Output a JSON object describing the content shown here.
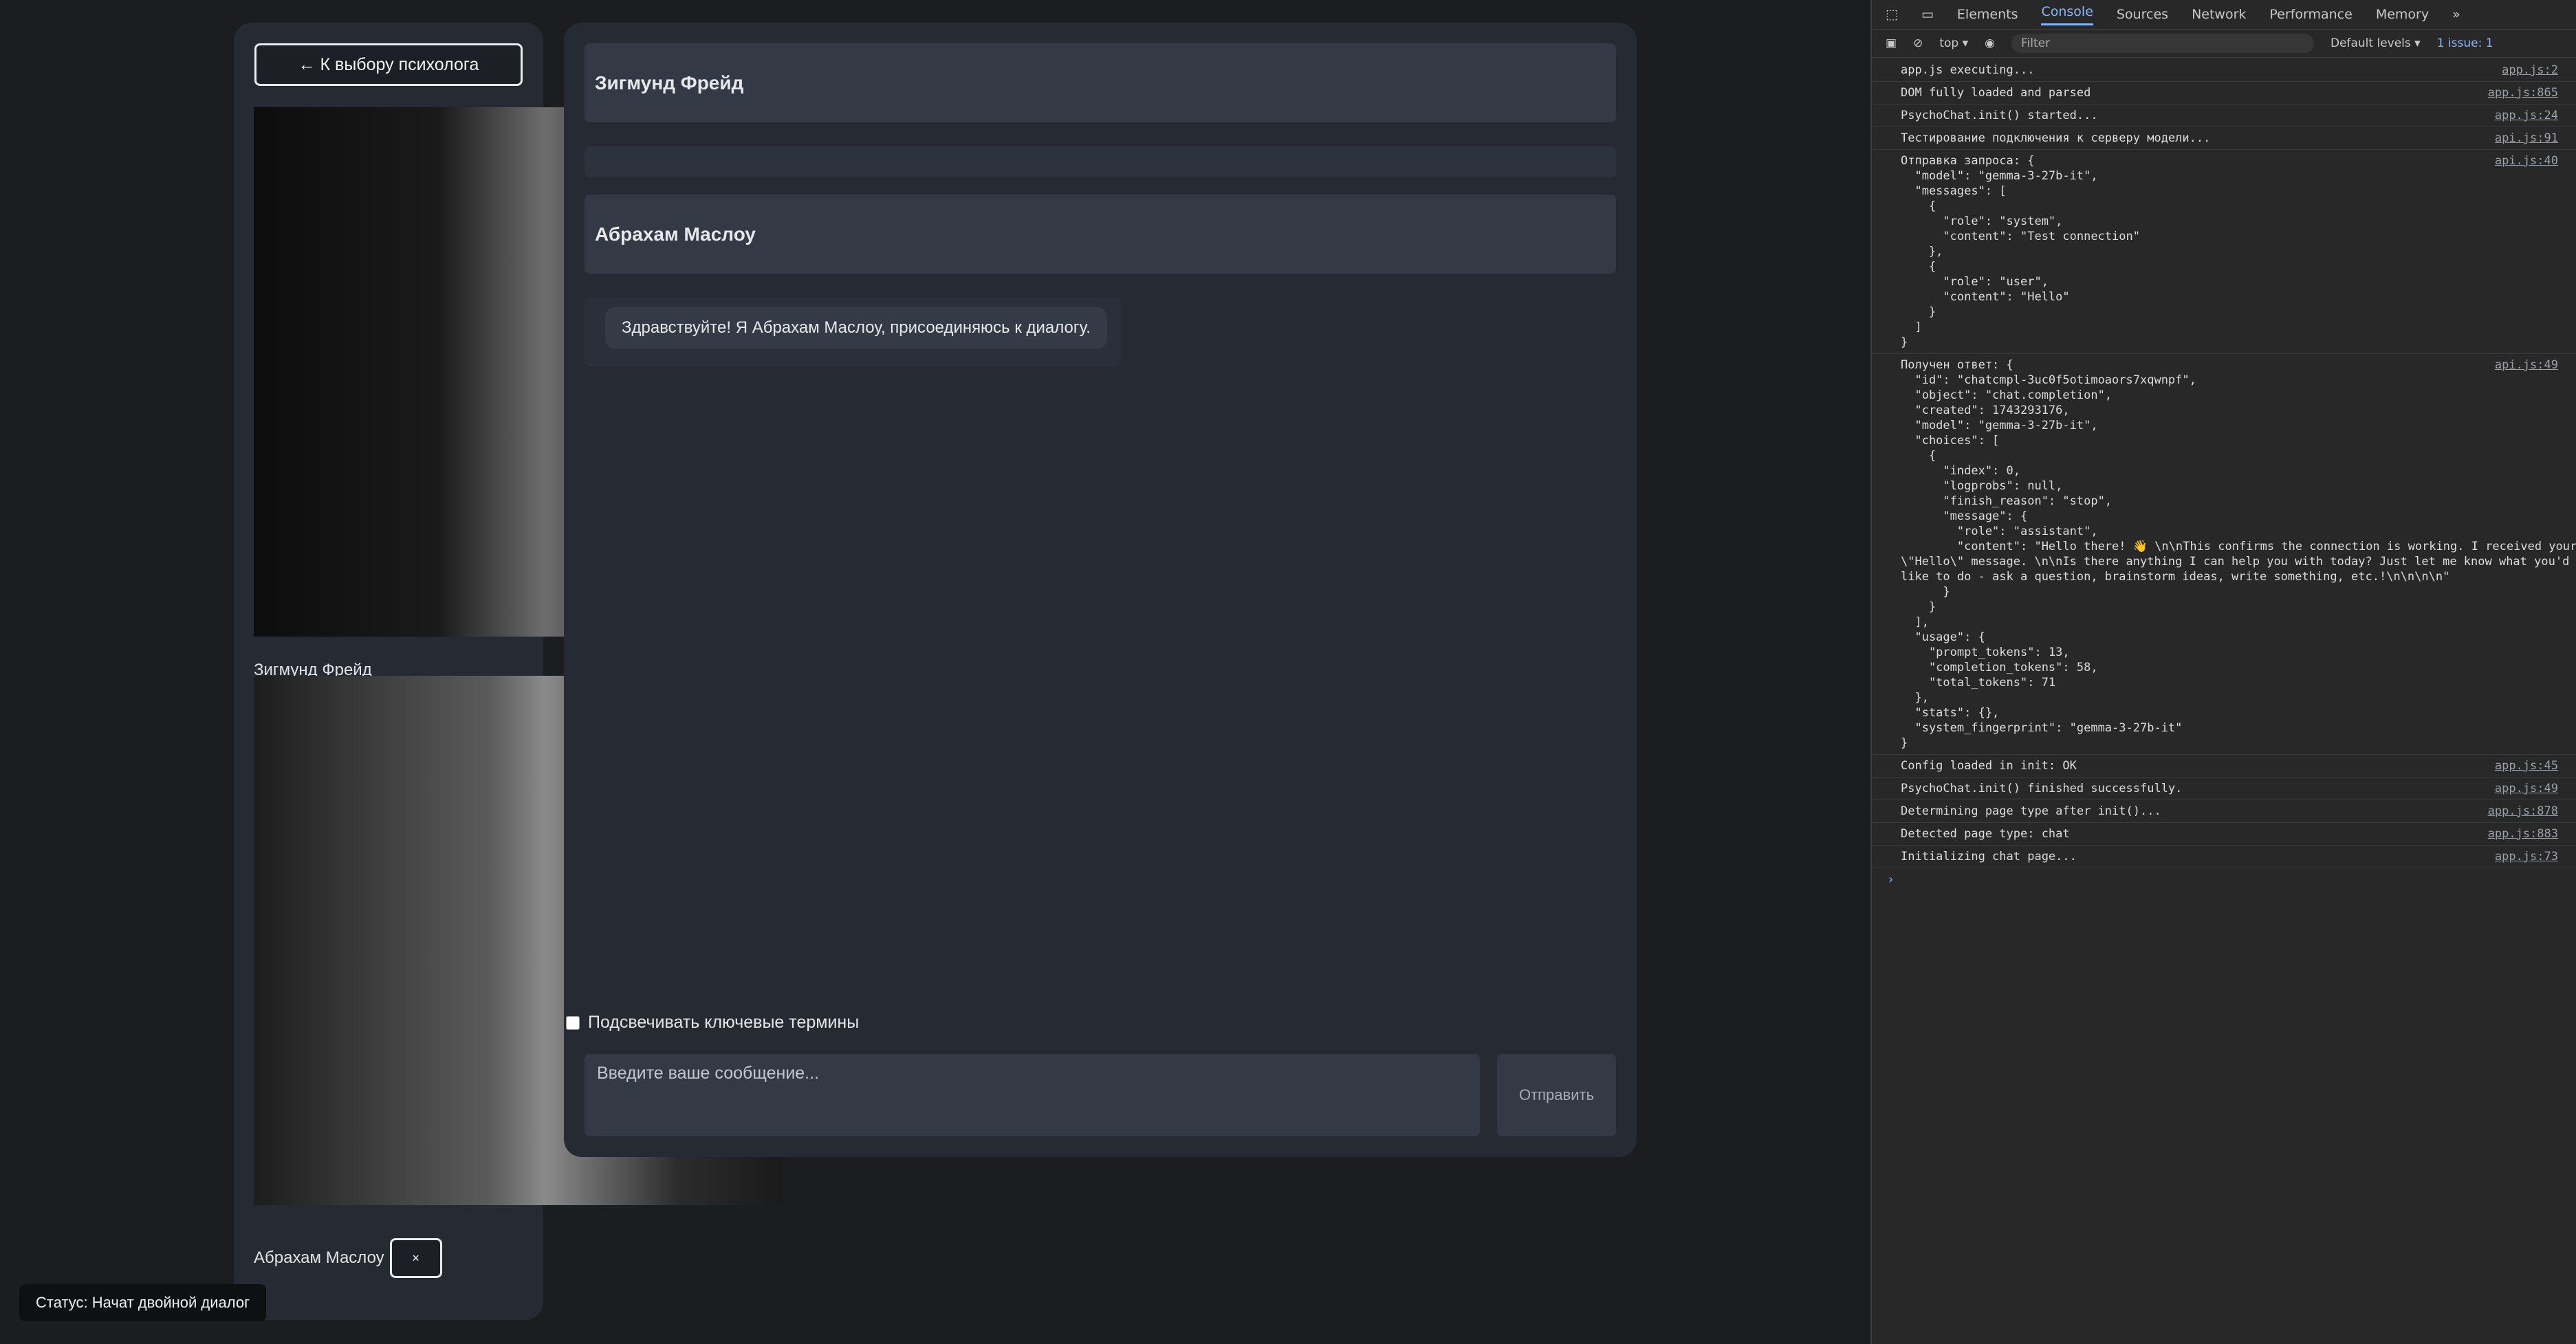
{
  "app": {
    "back_button": "← К выбору психолога",
    "psychologists": [
      {
        "name": "Зигмунд Фрейд"
      },
      {
        "name": "Абрахам Маслоу",
        "remove_label": "×"
      }
    ],
    "chat_headers": [
      "Зигмунд Фрейд",
      "Абрахам Маслоу"
    ],
    "message": "Здравствуйте! Я Абрахам Маслоу, присоединяюсь к диалогу.",
    "highlight_label": "Подсвечивать ключевые термины",
    "input_placeholder": "Введите ваше сообщение...",
    "send_label": "Отправить",
    "status": "Статус: Начат двойной диалог"
  },
  "devtools": {
    "tabs": [
      "Elements",
      "Console",
      "Sources",
      "Network",
      "Performance",
      "Memory"
    ],
    "active_tab": "Console",
    "context": "top ▾",
    "filter_placeholder": "Filter",
    "levels": "Default levels ▾",
    "issues": "1 issue: 1",
    "logs": [
      {
        "text": "app.js executing...",
        "src": "app.js:2"
      },
      {
        "text": "DOM fully loaded and parsed",
        "src": "app.js:865"
      },
      {
        "text": "PsychoChat.init() started...",
        "src": "app.js:24"
      },
      {
        "text": "Тестирование подключения к серверу модели...",
        "src": "api.js:91"
      },
      {
        "text": "Отправка запроса: {\n  \"model\": \"gemma-3-27b-it\",\n  \"messages\": [\n    {\n      \"role\": \"system\",\n      \"content\": \"Test connection\"\n    },\n    {\n      \"role\": \"user\",\n      \"content\": \"Hello\"\n    }\n  ]\n}",
        "src": "api.js:40"
      },
      {
        "text": "Получен ответ: {\n  \"id\": \"chatcmpl-3uc0f5otimoaors7xqwnpf\",\n  \"object\": \"chat.completion\",\n  \"created\": 1743293176,\n  \"model\": \"gemma-3-27b-it\",\n  \"choices\": [\n    {\n      \"index\": 0,\n      \"logprobs\": null,\n      \"finish_reason\": \"stop\",\n      \"message\": {\n        \"role\": \"assistant\",\n        \"content\": \"Hello there! 👋 \\n\\nThis confirms the connection is working. I received your\n\\\"Hello\\\" message. \\n\\nIs there anything I can help you with today? Just let me know what you'd\nlike to do - ask a question, brainstorm ideas, write something, etc.!\\n\\n\\n\\n\"\n      }\n    }\n  ],\n  \"usage\": {\n    \"prompt_tokens\": 13,\n    \"completion_tokens\": 58,\n    \"total_tokens\": 71\n  },\n  \"stats\": {},\n  \"system_fingerprint\": \"gemma-3-27b-it\"\n}",
        "src": "api.js:49"
      },
      {
        "text": "Config loaded in init: OK",
        "src": "app.js:45"
      },
      {
        "text": "PsychoChat.init() finished successfully.",
        "src": "app.js:49"
      },
      {
        "text": "Determining page type after init()...",
        "src": "app.js:878"
      },
      {
        "text": "Detected page type: chat",
        "src": "app.js:883"
      },
      {
        "text": "Initializing chat page...",
        "src": "app.js:73"
      }
    ],
    "prompt": "›"
  }
}
